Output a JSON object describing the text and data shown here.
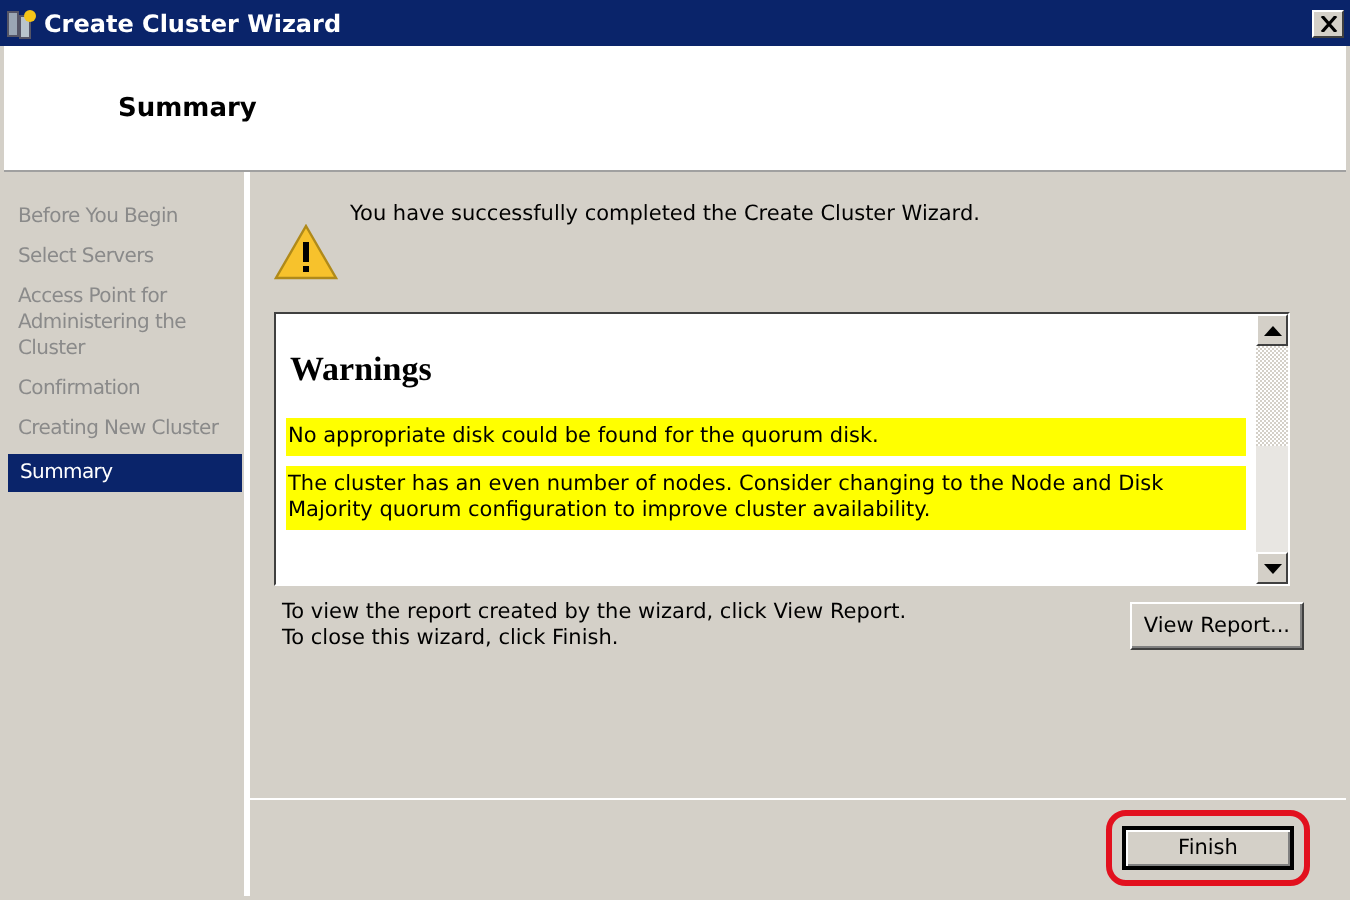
{
  "window": {
    "title": "Create Cluster Wizard"
  },
  "header": {
    "title": "Summary"
  },
  "sidebar": {
    "items": [
      {
        "label": "Before You Begin",
        "selected": false
      },
      {
        "label": "Select Servers",
        "selected": false
      },
      {
        "label": "Access Point for Administering the Cluster",
        "selected": false
      },
      {
        "label": "Confirmation",
        "selected": false
      },
      {
        "label": "Creating New Cluster",
        "selected": false
      },
      {
        "label": "Summary",
        "selected": true
      }
    ]
  },
  "message": "You have successfully completed the Create Cluster Wizard.",
  "report": {
    "heading": "Warnings",
    "warnings": [
      "No appropriate disk could be found for the quorum disk.",
      "The cluster has an even number of nodes. Consider changing to the Node and Disk Majority quorum configuration to improve cluster availability."
    ]
  },
  "instructions": [
    "To view the report created by the wizard, click View Report.",
    "To close this wizard, click Finish."
  ],
  "buttons": {
    "view_report": "View Report...",
    "finish": "Finish"
  }
}
